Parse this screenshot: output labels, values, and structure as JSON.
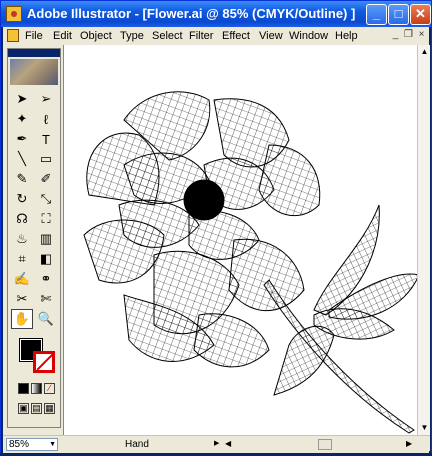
{
  "window": {
    "title": "Adobe Illustrator - [Flower.ai @ 85% (CMYK/Outline) ]",
    "minimize_label": "_",
    "maximize_label": "□",
    "close_label": "✕"
  },
  "menubar": {
    "items": [
      "File",
      "Edit",
      "Object",
      "Type",
      "Select",
      "Filter",
      "Effect",
      "View",
      "Window",
      "Help"
    ],
    "doc_min": "_",
    "doc_restore": "❐",
    "doc_close": "×"
  },
  "toolbox": {
    "tools": [
      "selection-tool",
      "direct-selection-tool",
      "magic-wand-tool",
      "lasso-tool",
      "pen-tool",
      "type-tool",
      "line-tool",
      "rectangle-tool",
      "paintbrush-tool",
      "pencil-tool",
      "rotate-tool",
      "scale-tool",
      "warp-tool",
      "free-transform-tool",
      "symbol-sprayer-tool",
      "graph-tool",
      "mesh-tool",
      "gradient-tool",
      "eyedropper-tool",
      "blend-tool",
      "slice-tool",
      "scissors-tool",
      "hand-tool",
      "zoom-tool"
    ],
    "glyphs": [
      "➤",
      "➢",
      "✦",
      "ℓ",
      "✒",
      "T",
      "╲",
      "▭",
      "✎",
      "✐",
      "↻",
      "⤡",
      "☊",
      "⛶",
      "♨",
      "▥",
      "⌗",
      "◧",
      "✍",
      "⚭",
      "✂",
      "✄",
      "✋",
      "🔍"
    ],
    "active_tool": "hand-tool",
    "mode_buttons": [
      "■",
      "◧",
      "∕"
    ],
    "view_buttons": [
      "▣",
      "▤",
      "▦"
    ]
  },
  "statusbar": {
    "zoom": "85%",
    "tool_name": "Hand",
    "nav_prev": "◀",
    "nav_next": "▶"
  },
  "scrollbar": {
    "up": "▲",
    "down": "▼",
    "left": "◀",
    "right": "▶"
  },
  "colors": {
    "titlebar": "#0a4ad0",
    "fill": "#000000",
    "stroke_none": "#dd0000"
  }
}
